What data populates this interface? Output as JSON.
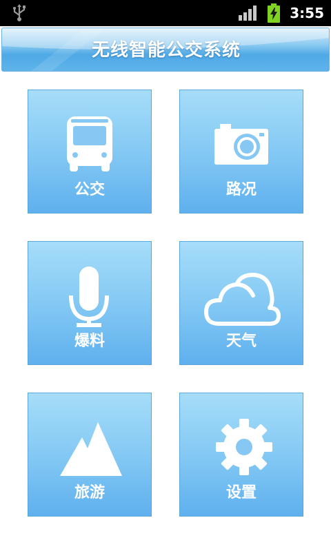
{
  "status_bar": {
    "time": "3:55",
    "usb_icon": "usb-icon",
    "signal_icon": "signal-icon",
    "battery_icon": "battery-charging-icon"
  },
  "header": {
    "title": "无线智能公交系统"
  },
  "menu": {
    "items": [
      {
        "label": "公交",
        "icon": "bus-icon"
      },
      {
        "label": "路况",
        "icon": "camera-icon"
      },
      {
        "label": "爆料",
        "icon": "microphone-icon"
      },
      {
        "label": "天气",
        "icon": "cloud-icon"
      },
      {
        "label": "旅游",
        "icon": "mountain-icon"
      },
      {
        "label": "设置",
        "icon": "gear-icon"
      }
    ]
  },
  "colors": {
    "status_bar_bg": "#000000",
    "header_blue": "#4ea9e6",
    "tile_top": "#a6ddf9",
    "tile_bottom": "#5fb0ee",
    "battery_green": "#7fd321",
    "icon_white": "#ffffff"
  }
}
